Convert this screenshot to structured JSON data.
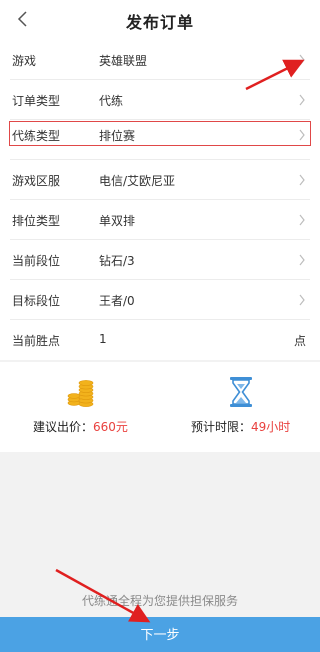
{
  "header": {
    "title": "发布订单"
  },
  "form": {
    "rows": [
      {
        "label": "游戏",
        "value": "英雄联盟"
      },
      {
        "label": "订单类型",
        "value": "代练"
      },
      {
        "label": "代练类型",
        "value": "排位赛"
      },
      {
        "label": "游戏区服",
        "value": "电信/艾欧尼亚"
      },
      {
        "label": "排位类型",
        "value": "单双排"
      },
      {
        "label": "当前段位",
        "value": "钻石/3"
      },
      {
        "label": "目标段位",
        "value": "王者/0"
      },
      {
        "label": "当前胜点",
        "value": "1",
        "unit": "点"
      }
    ]
  },
  "estimate": {
    "price_label": "建议出价：",
    "price_value": "660元",
    "time_label": "预计时限：",
    "time_value": "49小时"
  },
  "footer": {
    "note": "代练通全程为您提供担保服务",
    "next_label": "下一步"
  },
  "colors": {
    "accent": "#4ba2e4",
    "highlight": "#e04848",
    "price": "#e9413e",
    "coin": "#f2b21c",
    "hourglass": "#3f8fd6"
  }
}
